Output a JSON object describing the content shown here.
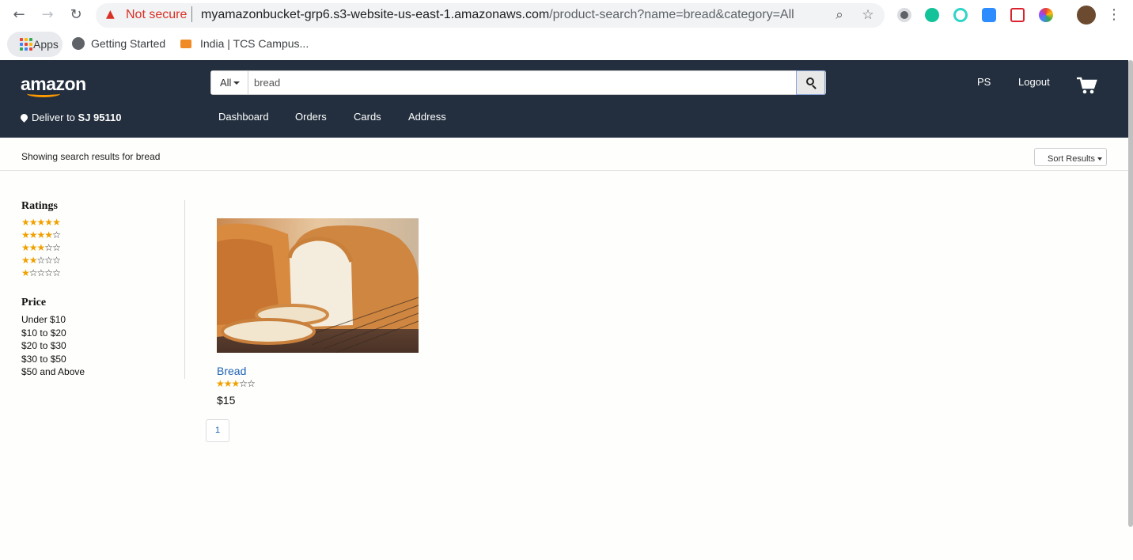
{
  "browser": {
    "not_secure": "Not secure",
    "url_host": "myamazonbucket-grp6.s3-website-us-east-1.amazonaws.com",
    "url_path": "/product-search?name=bread&category=All",
    "bookmarks": [
      "Apps",
      "Getting Started",
      "India | TCS Campus..."
    ]
  },
  "header": {
    "logo": "amazon",
    "deliver_prefix": "Deliver to",
    "deliver_location": "SJ 95110",
    "search_category": "All",
    "search_value": "bread",
    "user_initials": "PS",
    "logout": "Logout",
    "nav": [
      "Dashboard",
      "Orders",
      "Cards",
      "Address"
    ]
  },
  "results": {
    "text": "Showing search results for bread",
    "sort_label": "Sort Results"
  },
  "sidebar": {
    "ratings_heading": "Ratings",
    "ratings": [
      5,
      4,
      3,
      2,
      1
    ],
    "price_heading": "Price",
    "price_ranges": [
      "Under $10",
      "$10 to $20",
      "$20 to $30",
      "$30 to $50",
      "$50 and Above"
    ]
  },
  "product": {
    "name": "Bread",
    "rating": 3,
    "price": "$15"
  },
  "pagination": {
    "current_page": "1"
  },
  "colors": {
    "header_bg": "#232f3e",
    "accent_orange": "#ff9900",
    "link_blue": "#1f63b6",
    "star_gold": "#f0a000"
  }
}
